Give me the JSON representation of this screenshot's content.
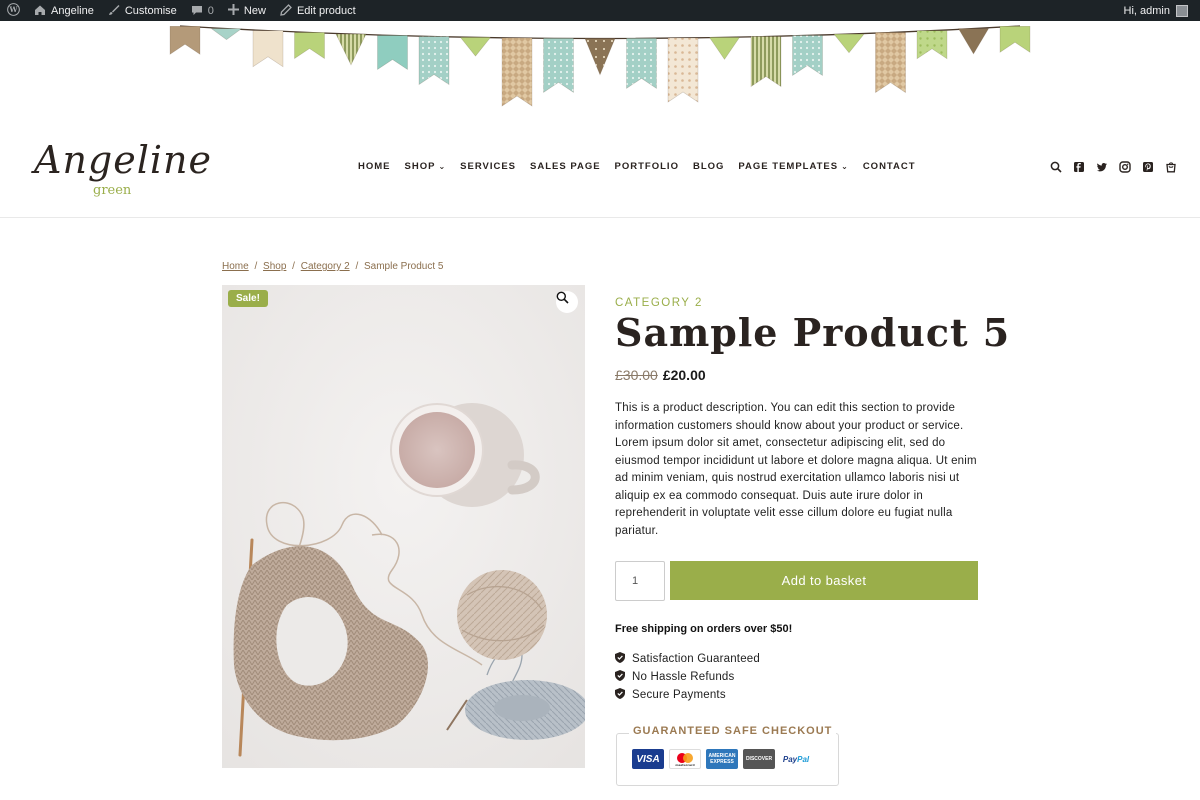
{
  "adminbar": {
    "site_name": "Angeline",
    "customise": "Customise",
    "comments_count": "0",
    "new_label": "New",
    "edit_label": "Edit product",
    "greeting": "Hi, admin"
  },
  "logo": {
    "main": "Angeline",
    "sub": "green"
  },
  "nav": {
    "items": [
      {
        "label": "HOME",
        "dropdown": false
      },
      {
        "label": "SHOP",
        "dropdown": true
      },
      {
        "label": "SERVICES",
        "dropdown": false
      },
      {
        "label": "SALES PAGE",
        "dropdown": false
      },
      {
        "label": "PORTFOLIO",
        "dropdown": false
      },
      {
        "label": "BLOG",
        "dropdown": false
      },
      {
        "label": "PAGE TEMPLATES",
        "dropdown": true
      },
      {
        "label": "CONTACT",
        "dropdown": false
      }
    ]
  },
  "header_icons": [
    "search-icon",
    "facebook-icon",
    "twitter-icon",
    "instagram-icon",
    "pinterest-icon",
    "cart-icon"
  ],
  "breadcrumb": {
    "home": "Home",
    "shop": "Shop",
    "category": "Category 2",
    "sep": "/",
    "current": "Sample Product 5"
  },
  "product": {
    "sale_badge": "Sale!",
    "category": "CATEGORY 2",
    "title": "Sample Product 5",
    "price_old": "£30.00",
    "price_new": "£20.00",
    "description": "This is a product description. You can edit this section to provide information customers should know about your product or service. Lorem ipsum dolor sit amet, consectetur adipiscing elit, sed do eiusmod tempor incididunt ut labore et dolore magna aliqua. Ut enim ad minim veniam, quis nostrud exercitation ullamco laboris nisi ut aliquip ex ea commodo consequat. Duis aute irure dolor in reprehenderit in voluptate velit esse cillum dolore eu fugiat nulla pariatur.",
    "quantity": "1",
    "add_to_basket": "Add to basket",
    "shipping": "Free shipping on orders over $50!",
    "benefits": [
      "Satisfaction Guaranteed",
      "No Hassle Refunds",
      "Secure Payments"
    ],
    "checkout_title": "GUARANTEED SAFE CHECKOUT",
    "cards": {
      "visa": "VISA",
      "mastercard": "mastercard",
      "amex_line1": "AMERICAN",
      "amex_line2": "EXPRESS",
      "discover": "DISCOVER",
      "paypal_a": "Pay",
      "paypal_b": "Pal"
    }
  },
  "colors": {
    "accent_green": "#9aae4a",
    "brown": "#8b6f4e",
    "admin_bar": "#1d2327"
  }
}
